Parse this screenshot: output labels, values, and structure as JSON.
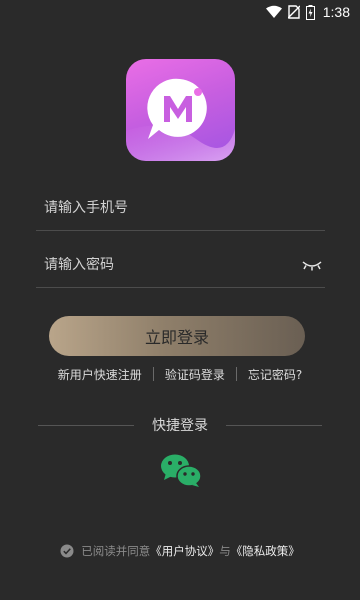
{
  "status_bar": {
    "time": "1:38",
    "icons": [
      "wifi-icon",
      "no-sim-icon",
      "battery-charging-icon"
    ]
  },
  "logo": {
    "letter": "Mi",
    "icon": "chat-bubble-logo-icon"
  },
  "form": {
    "phone_placeholder": "请输入手机号",
    "password_placeholder": "请输入密码",
    "password_toggle_icon": "eye-closed-icon"
  },
  "login_button_label": "立即登录",
  "links": {
    "register": "新用户快速注册",
    "code_login": "验证码登录",
    "forgot": "忘记密码?"
  },
  "quick_login": {
    "label": "快捷登录",
    "icon": "wechat-icon",
    "color": "#2aae67"
  },
  "agreement": {
    "prefix": "已阅读并同意",
    "user_agreement": "《用户协议》",
    "conj": "与",
    "privacy_policy": "《隐私政策》"
  },
  "colors": {
    "background": "#2a2a2a",
    "button_start": "#b9a58a",
    "button_end": "#6a5f53",
    "logo_pink": "#ea6ee6",
    "logo_purple": "#a054e2"
  }
}
